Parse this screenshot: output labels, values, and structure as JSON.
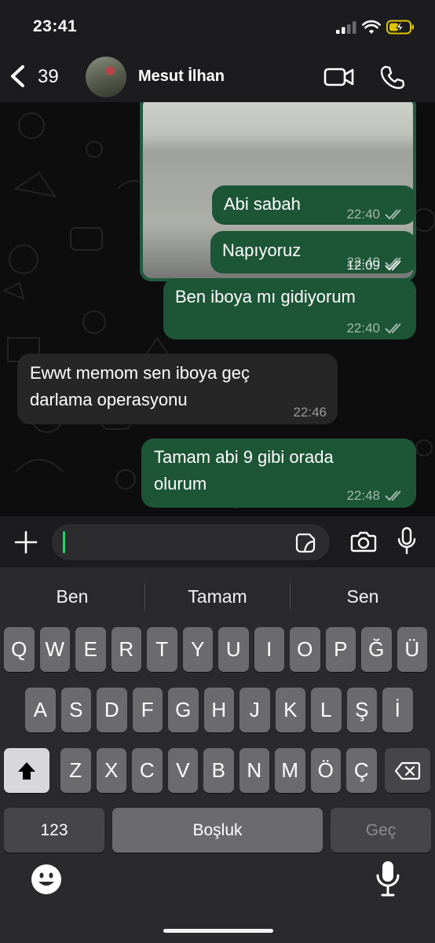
{
  "status_bar": {
    "time": "23:41"
  },
  "header": {
    "back_count": "39",
    "contact_name": "Mesut İlhan"
  },
  "messages": [
    {
      "direction": "out",
      "kind": "image",
      "time": "12:09"
    },
    {
      "direction": "out",
      "text": "Abi sabah",
      "time": "22:40"
    },
    {
      "direction": "out",
      "text": "Napıyoruz",
      "time": "22:40"
    },
    {
      "direction": "out",
      "text": "Ben iboya mı gidiyorum",
      "time": "22:40"
    },
    {
      "direction": "in",
      "lines": [
        "Ewwt memom sen iboya geç",
        "darlama operasyonu"
      ],
      "time": "22:46"
    },
    {
      "direction": "out",
      "lines": [
        "Tamam abi 9 gibi orada",
        "olurum"
      ],
      "time": "22:48"
    }
  ],
  "keyboard": {
    "suggestions": [
      "Ben",
      "Tamam",
      "Sen"
    ],
    "row1": [
      "Q",
      "W",
      "E",
      "R",
      "T",
      "Y",
      "U",
      "I",
      "O",
      "P",
      "Ğ",
      "Ü"
    ],
    "row2": [
      "A",
      "S",
      "D",
      "F",
      "G",
      "H",
      "J",
      "K",
      "L",
      "Ş",
      "İ"
    ],
    "row3": [
      "Z",
      "X",
      "C",
      "V",
      "B",
      "N",
      "M",
      "Ö",
      "Ç"
    ],
    "numbers_label": "123",
    "space_label": "Boşluk",
    "return_label": "Geç"
  },
  "colors": {
    "outgoing_bubble": "#1d5537",
    "incoming_bubble": "#262626",
    "caret": "#25d366"
  }
}
